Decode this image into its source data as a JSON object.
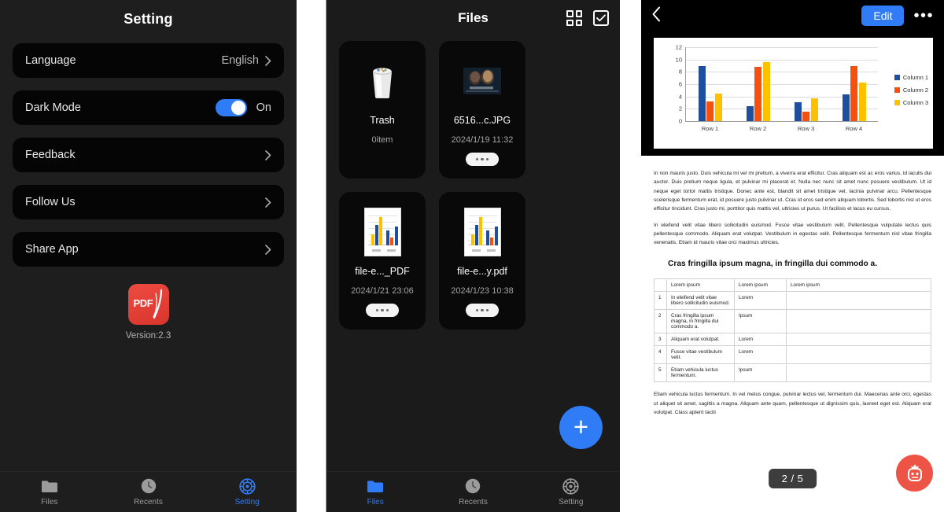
{
  "colors": {
    "accent_blue": "#2f7cf6",
    "panel_bg": "#1e1e1e",
    "card_bg": "#090909",
    "pdf_red": "#d8352c",
    "mascot_red": "#ee5445",
    "series1": "#1f4e9c",
    "series2": "#f4500f",
    "series3": "#ffc000"
  },
  "settings_screen": {
    "title": "Setting",
    "rows": [
      {
        "label": "Language",
        "value": "English",
        "control": "chevron",
        "icon": "chevron-right-icon"
      },
      {
        "label": "Dark Mode",
        "value": "On",
        "control": "toggle",
        "toggle_on": true
      },
      {
        "label": "Feedback",
        "value": "",
        "control": "chevron",
        "icon": "chevron-right-icon"
      },
      {
        "label": "Follow Us",
        "value": "",
        "control": "chevron",
        "icon": "chevron-right-icon"
      },
      {
        "label": "Share App",
        "value": "",
        "control": "chevron",
        "icon": "chevron-right-icon"
      }
    ],
    "brand": {
      "logo_text": "PDF",
      "logo_icon": "pdf-app-logo-icon",
      "version": "Version:2.3"
    },
    "tabbar": [
      {
        "label": "Files",
        "icon": "folder-icon",
        "active": false
      },
      {
        "label": "Recents",
        "icon": "clock-icon",
        "active": false
      },
      {
        "label": "Setting",
        "icon": "gear-icon",
        "active": true
      }
    ]
  },
  "files_screen": {
    "title": "Files",
    "header_icons": [
      {
        "name": "grid-view-icon",
        "label": "Grid view"
      },
      {
        "name": "select-checkbox-icon",
        "label": "Select"
      }
    ],
    "cards": [
      {
        "name": "Trash",
        "meta": "0item",
        "thumb": "trash-icon",
        "has_dots": false
      },
      {
        "name": "6516...c.JPG",
        "meta": "2024/1/19 11:32",
        "thumb": "image-thumbnail",
        "has_dots": true
      },
      {
        "name": "file-e..._PDF",
        "meta": "2024/1/21 23:06",
        "thumb": "chart-document-thumbnail",
        "has_dots": true
      },
      {
        "name": "file-e...y.pdf",
        "meta": "2024/1/23 10:38",
        "thumb": "chart-document-thumbnail",
        "has_dots": true
      }
    ],
    "fab": {
      "icon": "plus-icon",
      "label": "+"
    },
    "tabbar": [
      {
        "label": "Files",
        "icon": "folder-icon",
        "active": true
      },
      {
        "label": "Recents",
        "icon": "clock-icon",
        "active": false
      },
      {
        "label": "Setting",
        "icon": "gear-icon",
        "active": false
      }
    ]
  },
  "viewer_screen": {
    "back_icon": "chevron-left-icon",
    "edit_label": "Edit",
    "more_icon": "more-horizontal-icon",
    "page_indicator": "2 / 5",
    "mascot_icon": "robot-assistant-icon",
    "paragraphs": [
      "In non mauris justo. Duis vehicula mi vel mi pretium, a viverra erat efficitur. Cras aliquam est ac eros varius, id iaculis dui auctor. Duis pretium neque ligula, et pulvinar mi placerat et. Nulla nec nunc sit amet nunc posuere vestibulum. Ut id neque eget tortor mattis tristique. Donec ante est, blandit sit amet tristique vel, lacinia pulvinar arcu. Pellentesque scelerisque fermentum erat, id posuere justo pulvinar ut. Cras id eros sed enim aliquam lobortis. Sed lobortis nisl ut eros efficitur tincidunt. Cras justo mi, porttitor quis mattis vel, ultricies ut purus. Ut facilisis et lacus eu cursus.",
      "In eleifend velit vitae libero sollicitudin euismod. Fusce vitae vestibulum velit. Pellentesque vulputate lectus quis pellentesque commodo. Aliquam erat volutpat. Vestibulum in egestas velit. Pellentesque fermentum nisl vitae fringilla venenatis. Etiam id mauris vitae orci maximus ultricies."
    ],
    "heading": "Cras fringilla ipsum magna, in fringilla dui commodo a.",
    "table": {
      "columns": [
        "",
        "Lorem ipsum",
        "Lorem ipsum",
        "Lorem ipsum"
      ],
      "rows": [
        [
          "1",
          "In eleifend velit vitae libero sollicitudin euismod.",
          "Lorem",
          ""
        ],
        [
          "2",
          "Cras fringilla ipsum magna, in fringilla dui commodo a.",
          "Ipsum",
          ""
        ],
        [
          "3",
          "Aliquam erat volutpat.",
          "Lorem",
          ""
        ],
        [
          "4",
          "Fusce vitae vestibulum velit.",
          "Lorem",
          ""
        ],
        [
          "5",
          "Etiam vehicula luctus fermentum.",
          "Ipsum",
          ""
        ]
      ]
    },
    "footer_paragraph": "Etiam vehicula luctus fermentum. In vel metus congue, pulvinar lectus vel, fermentum dui. Maecenas ante orci, egestas ut aliquet sit amet, sagittis a magna. Aliquam ante quam, pellentesque ut dignissim quis, laoreet eget est. Aliquam erat volutpat. Class aptent taciti"
  },
  "chart_data": {
    "type": "bar",
    "title": "",
    "xlabel": "",
    "ylabel": "",
    "categories": [
      "Row 1",
      "Row 2",
      "Row 3",
      "Row 4"
    ],
    "series": [
      {
        "name": "Column 1",
        "color": "#1f4e9c",
        "values": [
          9.0,
          2.4,
          3.1,
          4.3
        ]
      },
      {
        "name": "Column 2",
        "color": "#f4500f",
        "values": [
          3.2,
          8.8,
          1.5,
          9.0
        ]
      },
      {
        "name": "Column 3",
        "color": "#ffc000",
        "values": [
          4.5,
          9.6,
          3.7,
          6.2
        ]
      }
    ],
    "yticks": [
      0,
      2,
      4,
      6,
      8,
      10,
      12
    ],
    "ylim": [
      0,
      12
    ],
    "grid": true,
    "legend_position": "right"
  }
}
